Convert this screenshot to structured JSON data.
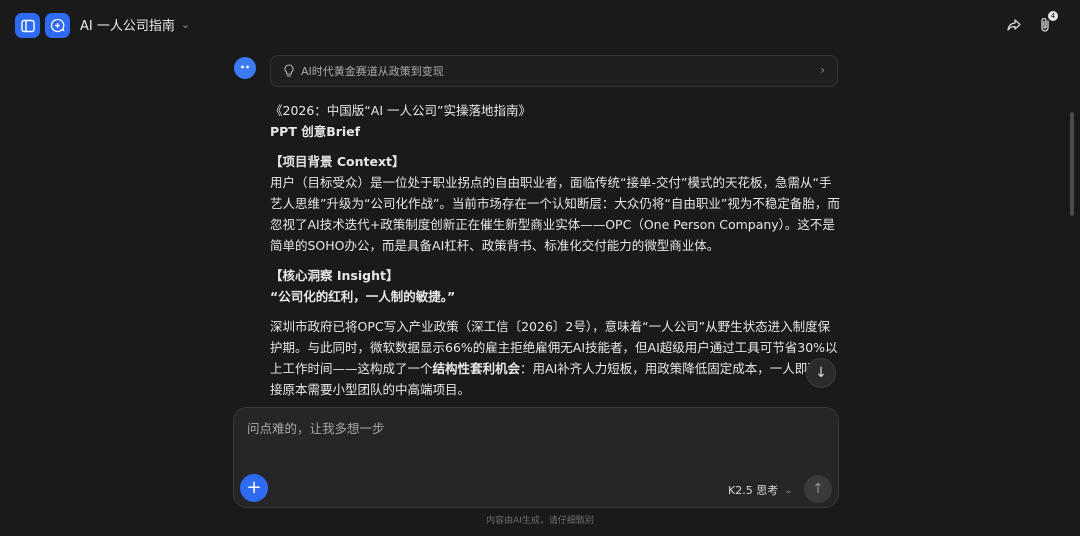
{
  "header": {
    "title": "AI 一人公司指南",
    "share_badge_count": "4"
  },
  "thinking": {
    "label": "AI时代黄金赛道从政策到变现"
  },
  "message": {
    "line1": "《2026：中国版“AI 一人公司”实操落地指南》",
    "line2": "PPT 创意Brief",
    "section1_title": "【项目背景 Context】",
    "section1_body": "用户（目标受众）是一位处于职业拐点的自由职业者，面临传统“接单-交付”模式的天花板，急需从“手艺人思维”升级为“公司化作战”。当前市场存在一个认知断层：大众仍将“自由职业”视为不稳定备胎，而忽视了AI技术迭代+政策制度创新正在催生新型商业实体——OPC（One Person Company）。这不是简单的SOHO办公，而是具备AI杠杆、政策背书、标准化交付能力的微型商业体。",
    "section2_title": "【核心洞察 Insight】",
    "section2_quote": "“公司化的红利，一人制的敏捷。”",
    "section3_part1": "深圳市政府已将OPC写入产业政策（深工信〔2026〕2号），意味着“一人公司”从野生状态进入制度保护期。与此同时，微软数据显示66%的雇主拒绝雇佣无AI技能者，但AI超级用户通过工具可节省30%以上工作时间——这构成了一个",
    "section3_bold": "结构性套利机会",
    "section3_part2": "：用AI补齐人力短板，用政策降低固定成本，一人即可承接原本需要小型团队的中高端项目。"
  },
  "composer": {
    "placeholder": "问点难的，让我多想一步",
    "model_label": "K2.5 思考"
  },
  "footer": {
    "disclaimer": "内容由AI生成，请仔细甄别"
  }
}
